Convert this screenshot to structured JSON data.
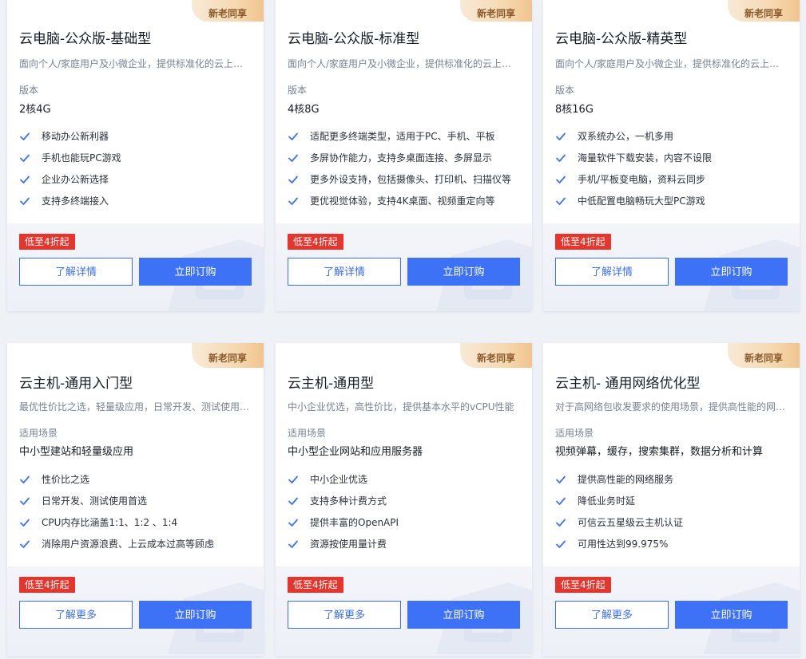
{
  "common": {
    "badge": "新老同享",
    "discount": "低至4折起",
    "buy_label": "立即订购"
  },
  "cards": [
    {
      "title": "云电脑-公众版-基础型",
      "desc": "面向个人/家庭用户及小微企业，提供标准化的云上电脑服务",
      "spec_label": "版本",
      "spec_value": "2核4G",
      "features": [
        "移动办公新利器",
        "手机也能玩PC游戏",
        "企业办公新选择",
        "支持多终端接入"
      ],
      "more_label": "了解详情"
    },
    {
      "title": "云电脑-公众版-标准型",
      "desc": "面向个人/家庭用户及小微企业，提供标准化的云上电脑服务",
      "spec_label": "版本",
      "spec_value": "4核8G",
      "features": [
        "适配更多终端类型，适用于PC、手机、平板",
        "多屏协作能力，支持多桌面连接、多屏显示",
        "更多外设支持，包括摄像头、打印机、扫描仪等",
        "更优视觉体验，支持4K桌面、视频重定向等"
      ],
      "more_label": "了解详情"
    },
    {
      "title": "云电脑-公众版-精英型",
      "desc": "面向个人/家庭用户及小微企业，提供标准化的云上电脑服务",
      "spec_label": "版本",
      "spec_value": "8核16G",
      "features": [
        "双系统办公，一机多用",
        "海量软件下载安装，内容不设限",
        "手机/平板变电脑，资料云同步",
        "中低配置电脑畅玩大型PC游戏"
      ],
      "more_label": "了解详情"
    },
    {
      "title": "云主机-通用入门型",
      "desc": "最优性价比之选，轻量级应用，日常开发、测试使用首选",
      "spec_label": "适用场景",
      "spec_value": "中小型建站和轻量级应用",
      "features": [
        "性价比之选",
        "日常开发、测试使用首选",
        "CPU内存比涵盖1:1、1:2 、1:4",
        "消除用户资源浪费、上云成本过高等顾虑"
      ],
      "more_label": "了解更多"
    },
    {
      "title": "云主机-通用型",
      "desc": "中小企业优选，高性价比，提供基本水平的vCPU性能",
      "spec_label": "适用场景",
      "spec_value": "中小型企业网站和应用服务器",
      "features": [
        "中小企业优选",
        "支持多种计费方式",
        "提供丰富的OpenAPI",
        "资源按使用量计费"
      ],
      "more_label": "了解更多"
    },
    {
      "title": "云主机- 通用网络优化型",
      "desc": "对于高网络包收发要求的使用场景，提供高性能的网络服务",
      "spec_label": "适用场景",
      "spec_value": "视频弹幕，缓存，搜索集群，数据分析和计算",
      "features": [
        "提供高性能的网络服务",
        "降低业务时延",
        "可信云五星级云主机认证",
        "可用性达到99.975%"
      ],
      "more_label": "了解更多"
    }
  ],
  "colors": {
    "primary": "#3d72f6",
    "discount_red": "#e5352c",
    "badge_gold": "#f6d9b3",
    "background": "#eef1f6"
  }
}
